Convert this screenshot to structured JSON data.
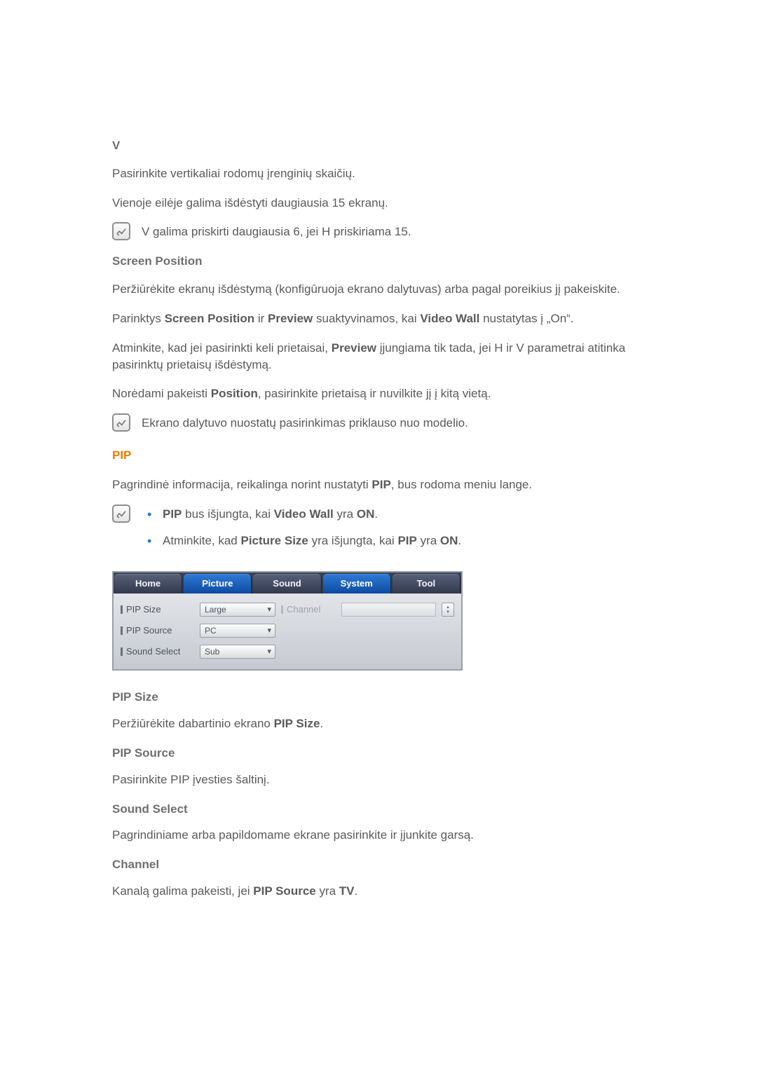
{
  "section_v": {
    "heading": "V",
    "p1": "Pasirinkite vertikaliai rodomų įrenginių skaičių.",
    "p2": "Vienoje eilėje galima išdėstyti daugiausia 15 ekranų.",
    "note": "V galima priskirti daugiausia 6, jei H priskiriama 15."
  },
  "section_sp": {
    "heading": "Screen Position",
    "p1a": "Peržiūrėkite ekranų išdėstymą (konfigūruoja ekrano dalytuvas) arba pagal poreikius jį pakeiskite.",
    "p2_pre": "Parinktys ",
    "p2_b1": "Screen Position",
    "p2_mid1": " ir ",
    "p2_b2": "Preview",
    "p2_mid2": " suaktyvinamos, kai ",
    "p2_b3": "Video Wall",
    "p2_post": " nustatytas į „On“.",
    "p3_pre": "Atminkite, kad jei pasirinkti keli prietaisai, ",
    "p3_b1": "Preview",
    "p3_post": " įjungiama tik tada, jei H ir V parametrai atitinka pasirinktų prietaisų išdėstymą.",
    "p4_pre": "Norėdami pakeisti ",
    "p4_b1": "Position",
    "p4_post": ", pasirinkite prietaisą ir nuvilkite jį į kitą vietą.",
    "note": "Ekrano dalytuvo nuostatų pasirinkimas priklauso nuo modelio."
  },
  "section_pip": {
    "heading": "PIP",
    "p1_pre": "Pagrindinė informacija, reikalinga norint nustatyti ",
    "p1_b1": "PIP",
    "p1_post": ", bus rodoma meniu lange.",
    "note_li1_b1": "PIP",
    "note_li1_mid": " bus išjungta, kai ",
    "note_li1_b2": "Video Wall",
    "note_li1_mid2": " yra ",
    "note_li1_b3": "ON",
    "note_li1_post": ".",
    "note_li2_pre": "Atminkite, kad ",
    "note_li2_b1": "Picture Size",
    "note_li2_mid": " yra išjungta, kai ",
    "note_li2_b2": "PIP",
    "note_li2_mid2": " yra ",
    "note_li2_b3": "ON",
    "note_li2_post": "."
  },
  "pip_table": {
    "tabs": {
      "home": "Home",
      "picture": "Picture",
      "sound": "Sound",
      "system": "System",
      "tool": "Tool"
    },
    "rows": {
      "r1": {
        "label": "PIP Size",
        "value": "Large"
      },
      "r2": {
        "label": "PIP Source",
        "value": "PC"
      },
      "r3": {
        "label": "Sound Select",
        "value": "Sub"
      }
    },
    "channel": {
      "label": "Channel"
    }
  },
  "sub": {
    "pipsize_h": "PIP Size",
    "pipsize_p_pre": "Peržiūrėkite dabartinio ekrano ",
    "pipsize_p_b": "PIP Size",
    "pipsize_p_post": ".",
    "pipsrc_h": "PIP Source",
    "pipsrc_p": "Pasirinkite PIP įvesties šaltinį.",
    "sound_h": "Sound Select",
    "sound_p": "Pagrindiniame arba papildomame ekrane pasirinkite ir įjunkite garsą.",
    "chan_h": "Channel",
    "chan_p_pre": "Kanalą galima pakeisti, jei ",
    "chan_p_b1": "PIP Source",
    "chan_p_mid": " yra ",
    "chan_p_b2": "TV",
    "chan_p_post": "."
  }
}
